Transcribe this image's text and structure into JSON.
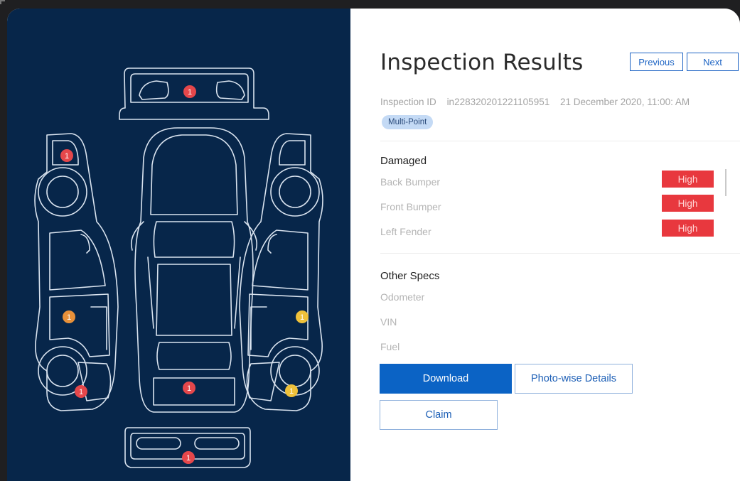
{
  "header": {
    "title": "Inspection Results",
    "previous_label": "Previous",
    "next_label": "Next"
  },
  "meta": {
    "id_label": "Inspection ID",
    "id_value": "in228320201221105951",
    "datetime": "21 December 2020, 11:00: AM",
    "tag": "Multi-Point"
  },
  "damaged": {
    "title": "Damaged",
    "items": [
      {
        "label": "Back Bumper",
        "severity": "High"
      },
      {
        "label": "Front Bumper",
        "severity": "High"
      },
      {
        "label": "Left Fender",
        "severity": "High"
      }
    ]
  },
  "other_specs": {
    "title": "Other Specs",
    "items": [
      "Odometer",
      "VIN",
      "Fuel"
    ]
  },
  "actions": {
    "download": "Download",
    "photo_details": "Photo-wise Details",
    "claim": "Claim"
  },
  "diagram": {
    "markers": [
      {
        "part": "rear-windshield",
        "count": "1",
        "color": "#e5474b"
      },
      {
        "part": "left-side-rear",
        "count": "1",
        "color": "#e5474b"
      },
      {
        "part": "left-side-door",
        "count": "1",
        "color": "#e8913a"
      },
      {
        "part": "left-side-front",
        "count": "1",
        "color": "#e5474b"
      },
      {
        "part": "roof",
        "count": "1",
        "color": "#e5474b"
      },
      {
        "part": "right-side-door",
        "count": "1",
        "color": "#efc13a"
      },
      {
        "part": "right-side-front",
        "count": "1",
        "color": "#efc13a"
      },
      {
        "part": "front-bumper",
        "count": "1",
        "color": "#e5474b"
      }
    ]
  },
  "colors": {
    "panel": "#07264a",
    "primary": "#0b63c5",
    "severity_high": "#e8383e",
    "chip_bg": "#c4daf5"
  }
}
